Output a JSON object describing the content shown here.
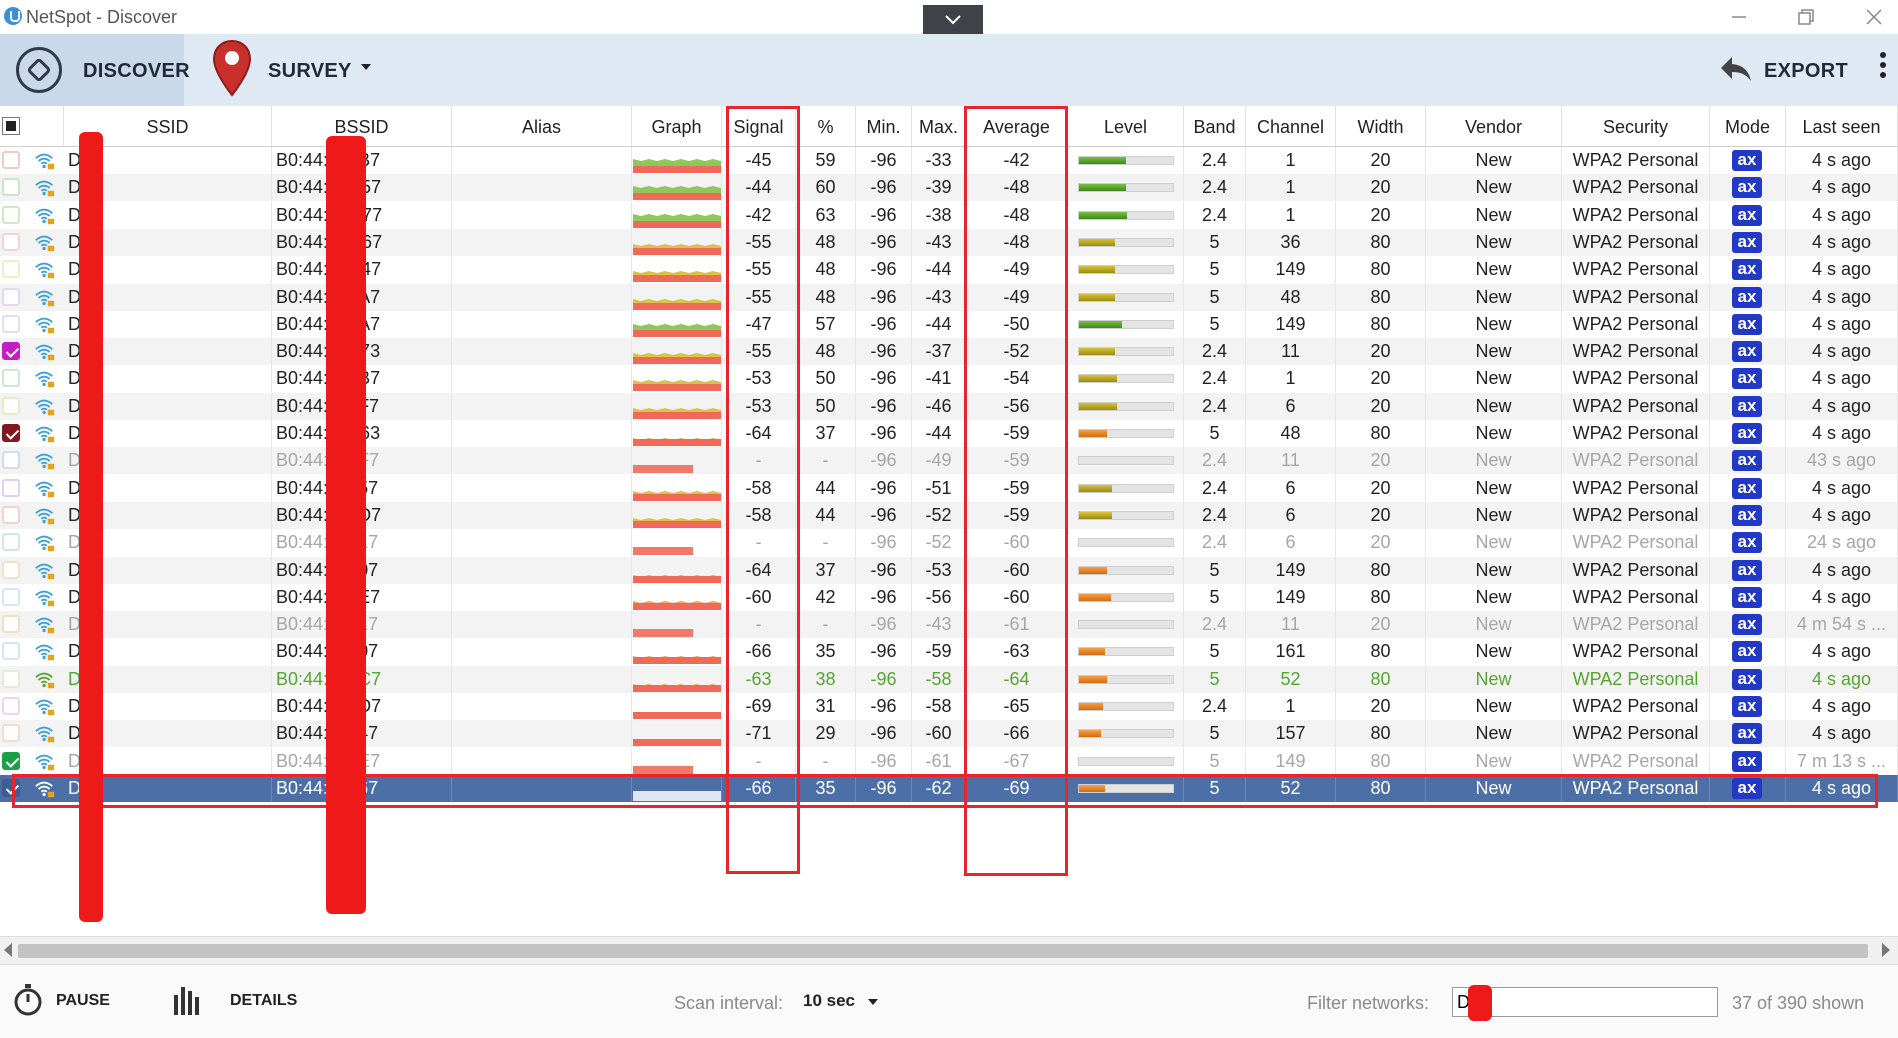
{
  "window": {
    "title": "NetSpot - Discover"
  },
  "toolbar": {
    "discover_label": "DISCOVER",
    "survey_label": "SURVEY",
    "export_label": "EXPORT"
  },
  "columns": [
    "SSID",
    "BSSID",
    "Alias",
    "Graph",
    "Signal",
    "%",
    "Min.",
    "Max.",
    "Average",
    "Level",
    "Band",
    "Channel",
    "Width",
    "Vendor",
    "Security",
    "Mode",
    "Last seen"
  ],
  "rows": [
    {
      "ssid": "D  2",
      "bssid": "B0:44:    97:B7",
      "signal": "-45",
      "pct": "59",
      "min": "-96",
      "max": "-33",
      "avg": "-42",
      "level": 0.62,
      "band": "2.4",
      "channel": "1",
      "width": "20",
      "vendor": "New",
      "security": "WPA2 Personal",
      "mode": "ax",
      "last_seen": "4 s ago",
      "checked": false,
      "cbcolor": "#f2c9c9",
      "state": "normal"
    },
    {
      "ssid": "D  2",
      "bssid": "B0:44:    0C:57",
      "signal": "-44",
      "pct": "60",
      "min": "-96",
      "max": "-39",
      "avg": "-48",
      "level": 0.62,
      "band": "2.4",
      "channel": "1",
      "width": "20",
      "vendor": "New",
      "security": "WPA2 Personal",
      "mode": "ax",
      "last_seen": "4 s ago",
      "checked": false,
      "cbcolor": "#c9e6c9",
      "state": "normal"
    },
    {
      "ssid": "D  2",
      "bssid": "B0:44:    AC:77",
      "signal": "-42",
      "pct": "63",
      "min": "-96",
      "max": "-38",
      "avg": "-48",
      "level": 0.64,
      "band": "2.4",
      "channel": "1",
      "width": "20",
      "vendor": "New",
      "security": "WPA2 Personal",
      "mode": "ax",
      "last_seen": "4 s ago",
      "checked": false,
      "cbcolor": "#cfe9c3",
      "state": "normal"
    },
    {
      "ssid": "D  2",
      "bssid": "B0:44:    AC:67",
      "signal": "-55",
      "pct": "48",
      "min": "-96",
      "max": "-43",
      "avg": "-48",
      "level": 0.48,
      "band": "5",
      "channel": "36",
      "width": "80",
      "vendor": "New",
      "security": "WPA2 Personal",
      "mode": "ax",
      "last_seen": "4 s ago",
      "checked": false,
      "cbcolor": "#f3d3d3",
      "state": "normal"
    },
    {
      "ssid": "D  2",
      "bssid": "B0:44:    0C:47",
      "signal": "-55",
      "pct": "48",
      "min": "-96",
      "max": "-44",
      "avg": "-49",
      "level": 0.48,
      "band": "5",
      "channel": "149",
      "width": "80",
      "vendor": "New",
      "security": "WPA2 Personal",
      "mode": "ax",
      "last_seen": "4 s ago",
      "checked": false,
      "cbcolor": "#f1ecc5",
      "state": "normal"
    },
    {
      "ssid": "D  2",
      "bssid": "B0:44:    97:A7",
      "signal": "-55",
      "pct": "48",
      "min": "-96",
      "max": "-43",
      "avg": "-49",
      "level": 0.48,
      "band": "5",
      "channel": "48",
      "width": "80",
      "vendor": "New",
      "security": "WPA2 Personal",
      "mode": "ax",
      "last_seen": "4 s ago",
      "checked": false,
      "cbcolor": "#e3d8ee",
      "state": "normal"
    },
    {
      "ssid": "D  2",
      "bssid": "B0:44:    95:A7",
      "signal": "-47",
      "pct": "57",
      "min": "-96",
      "max": "-44",
      "avg": "-50",
      "level": 0.57,
      "band": "5",
      "channel": "149",
      "width": "80",
      "vendor": "New",
      "security": "WPA2 Personal",
      "mode": "ax",
      "last_seen": "4 s ago",
      "checked": false,
      "cbcolor": "#e0e0e6",
      "state": "normal"
    },
    {
      "ssid": "D  2",
      "bssid": "B0:44:    0E:73",
      "signal": "-55",
      "pct": "48",
      "min": "-96",
      "max": "-37",
      "avg": "-52",
      "level": 0.48,
      "band": "2.4",
      "channel": "11",
      "width": "20",
      "vendor": "New",
      "security": "WPA2 Personal",
      "mode": "ax",
      "last_seen": "4 s ago",
      "checked": true,
      "cbcolor": "#c51ec5",
      "state": "normal"
    },
    {
      "ssid": "D  2",
      "bssid": "B0:44:    95:B7",
      "signal": "-53",
      "pct": "50",
      "min": "-96",
      "max": "-41",
      "avg": "-54",
      "level": 0.5,
      "band": "2.4",
      "channel": "1",
      "width": "20",
      "vendor": "New",
      "security": "WPA2 Personal",
      "mode": "ax",
      "last_seen": "4 s ago",
      "checked": false,
      "cbcolor": "#c9e9d3",
      "state": "normal"
    },
    {
      "ssid": "D  2",
      "bssid": "B0:44:    28:F7",
      "signal": "-53",
      "pct": "50",
      "min": "-96",
      "max": "-46",
      "avg": "-56",
      "level": 0.5,
      "band": "2.4",
      "channel": "6",
      "width": "20",
      "vendor": "New",
      "security": "WPA2 Personal",
      "mode": "ax",
      "last_seen": "4 s ago",
      "checked": false,
      "cbcolor": "#e6ecc1",
      "state": "normal"
    },
    {
      "ssid": "D  2",
      "bssid": "B0:44:    0E:63",
      "signal": "-64",
      "pct": "37",
      "min": "-96",
      "max": "-44",
      "avg": "-59",
      "level": 0.37,
      "band": "5",
      "channel": "48",
      "width": "80",
      "vendor": "New",
      "security": "WPA2 Personal",
      "mode": "ax",
      "last_seen": "4 s ago",
      "checked": true,
      "cbcolor": "#7d1a24",
      "state": "normal"
    },
    {
      "ssid": "D  2",
      "bssid": "B0:44:    97:F7",
      "signal": "-",
      "pct": "-",
      "min": "-96",
      "max": "-49",
      "avg": "-59",
      "level": 0,
      "band": "2.4",
      "channel": "11",
      "width": "20",
      "vendor": "New",
      "security": "WPA2 Personal",
      "mode": "ax",
      "last_seen": "43 s ago",
      "checked": false,
      "cbcolor": "#d3dcea",
      "state": "dim"
    },
    {
      "ssid": "D  2",
      "bssid": "B0:44:    29:57",
      "signal": "-58",
      "pct": "44",
      "min": "-96",
      "max": "-51",
      "avg": "-59",
      "level": 0.44,
      "band": "2.4",
      "channel": "6",
      "width": "20",
      "vendor": "New",
      "security": "WPA2 Personal",
      "mode": "ax",
      "last_seen": "4 s ago",
      "checked": false,
      "cbcolor": "#e0cfee",
      "state": "normal"
    },
    {
      "ssid": "D  2",
      "bssid": "B0:44:    96:D7",
      "signal": "-58",
      "pct": "44",
      "min": "-96",
      "max": "-52",
      "avg": "-59",
      "level": 0.44,
      "band": "2.4",
      "channel": "6",
      "width": "20",
      "vendor": "New",
      "security": "WPA2 Personal",
      "mode": "ax",
      "last_seen": "4 s ago",
      "checked": false,
      "cbcolor": "#f3d1d1",
      "state": "normal"
    },
    {
      "ssid": "D  2",
      "bssid": "B0:44:    90:17",
      "signal": "-",
      "pct": "-",
      "min": "-96",
      "max": "-52",
      "avg": "-60",
      "level": 0,
      "band": "2.4",
      "channel": "6",
      "width": "20",
      "vendor": "New",
      "security": "WPA2 Personal",
      "mode": "ax",
      "last_seen": "24 s ago",
      "checked": false,
      "cbcolor": "#cfe8e0",
      "state": "dim"
    },
    {
      "ssid": "D  2",
      "bssid": "B0:44:    93:07",
      "signal": "-64",
      "pct": "37",
      "min": "-96",
      "max": "-53",
      "avg": "-60",
      "level": 0.37,
      "band": "5",
      "channel": "149",
      "width": "80",
      "vendor": "New",
      "security": "WPA2 Personal",
      "mode": "ax",
      "last_seen": "4 s ago",
      "checked": false,
      "cbcolor": "#f1e3c8",
      "state": "normal"
    },
    {
      "ssid": "D  2",
      "bssid": "B0:44:    28:E7",
      "signal": "-60",
      "pct": "42",
      "min": "-96",
      "max": "-56",
      "avg": "-60",
      "level": 0.42,
      "band": "5",
      "channel": "149",
      "width": "80",
      "vendor": "New",
      "security": "WPA2 Personal",
      "mode": "ax",
      "last_seen": "4 s ago",
      "checked": false,
      "cbcolor": "#d6e6f3",
      "state": "normal"
    },
    {
      "ssid": "D  2",
      "bssid": "B0:44:    93:17",
      "signal": "-",
      "pct": "-",
      "min": "-96",
      "max": "-43",
      "avg": "-61",
      "level": 0,
      "band": "2.4",
      "channel": "11",
      "width": "20",
      "vendor": "New",
      "security": "WPA2 Personal",
      "mode": "ax",
      "last_seen": "4 m 54 s ...",
      "checked": false,
      "cbcolor": "#f1dfc3",
      "state": "dim"
    },
    {
      "ssid": "D  2",
      "bssid": "B0:44:    90:07",
      "signal": "-66",
      "pct": "35",
      "min": "-96",
      "max": "-59",
      "avg": "-63",
      "level": 0.35,
      "band": "5",
      "channel": "161",
      "width": "80",
      "vendor": "New",
      "security": "WPA2 Personal",
      "mode": "ax",
      "last_seen": "4 s ago",
      "checked": false,
      "cbcolor": "#d6e4f1",
      "state": "normal"
    },
    {
      "ssid": "D  2",
      "bssid": "B0:44:    96:C7",
      "signal": "-63",
      "pct": "38",
      "min": "-96",
      "max": "-58",
      "avg": "-64",
      "level": 0.38,
      "band": "5",
      "channel": "52",
      "width": "80",
      "vendor": "New",
      "security": "WPA2 Personal",
      "mode": "ax",
      "last_seen": "4 s ago",
      "checked": false,
      "cbcolor": "#dff0cf",
      "state": "hl"
    },
    {
      "ssid": "D  2",
      "bssid": "B0:44:    95:D7",
      "signal": "-69",
      "pct": "31",
      "min": "-96",
      "max": "-58",
      "avg": "-65",
      "level": 0.31,
      "band": "2.4",
      "channel": "1",
      "width": "20",
      "vendor": "New",
      "security": "WPA2 Personal",
      "mode": "ax",
      "last_seen": "4 s ago",
      "checked": false,
      "cbcolor": "#ead6f1",
      "state": "normal"
    },
    {
      "ssid": "D  2",
      "bssid": "B0:44:    29:47",
      "signal": "-71",
      "pct": "29",
      "min": "-96",
      "max": "-60",
      "avg": "-66",
      "level": 0.29,
      "band": "5",
      "channel": "157",
      "width": "80",
      "vendor": "New",
      "security": "WPA2 Personal",
      "mode": "ax",
      "last_seen": "4 s ago",
      "checked": false,
      "cbcolor": "#f3dccb",
      "state": "normal"
    },
    {
      "ssid": "D  2",
      "bssid": "B0:44:    97:E7",
      "signal": "-",
      "pct": "-",
      "min": "-96",
      "max": "-61",
      "avg": "-67",
      "level": 0,
      "band": "5",
      "channel": "149",
      "width": "80",
      "vendor": "New",
      "security": "WPA2 Personal",
      "mode": "ax",
      "last_seen": "7 m 13 s ...",
      "checked": true,
      "cbcolor": "#1f9e4a",
      "state": "dim"
    },
    {
      "ssid": "D  2",
      "bssid": "B0:44:    96:67",
      "signal": "-66",
      "pct": "35",
      "min": "-96",
      "max": "-62",
      "avg": "-69",
      "level": 0.35,
      "band": "5",
      "channel": "52",
      "width": "80",
      "vendor": "New",
      "security": "WPA2 Personal",
      "mode": "ax",
      "last_seen": "4 s ago",
      "checked": true,
      "cbcolor": "#3e5d91",
      "state": "sel"
    }
  ],
  "status": {
    "pause_label": "PAUSE",
    "details_label": "DETAILS",
    "scan_interval_label": "Scan interval:",
    "scan_interval_value": "10 sec",
    "filter_label": "Filter networks:",
    "filter_value": "D  2",
    "shown_count": "37 of 390 shown"
  },
  "icons": {
    "app": "netspot-app-icon",
    "collapse": "chevron-down-icon",
    "discover": "discover-icon",
    "survey": "map-pin-icon",
    "export": "export-arrow-icon",
    "more": "more-vertical-icon",
    "pause": "stopwatch-icon",
    "details": "equalizer-icon",
    "wifi": "wifi-lock-icon"
  },
  "colors": {
    "selected_row": "#4d6fa8",
    "highlight_text": "#55a630",
    "annotation": "#e8262a",
    "mode_badge": "#2238c7"
  }
}
